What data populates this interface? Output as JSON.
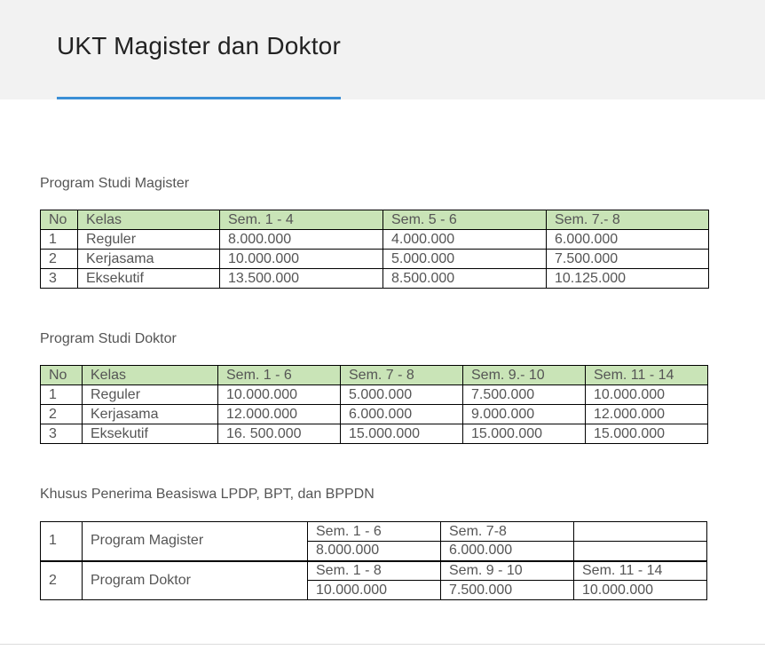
{
  "page": {
    "title": "UKT Magister dan Doktor"
  },
  "colors": {
    "header_bg": "#f2f2f2",
    "accent": "#3b8fd6",
    "table_header_bg": "#c9e4b7"
  },
  "magister": {
    "title": "Program Studi Magister",
    "headers": [
      "No",
      "Kelas",
      "Sem. 1 - 4",
      "Sem. 5 - 6",
      "Sem. 7.- 8"
    ],
    "rows": [
      [
        "1",
        "Reguler",
        "8.000.000",
        "4.000.000",
        "6.000.000"
      ],
      [
        "2",
        "Kerjasama",
        "10.000.000",
        "5.000.000",
        "7.500.000"
      ],
      [
        "3",
        "Eksekutif",
        "13.500.000",
        "8.500.000",
        "10.125.000"
      ]
    ]
  },
  "doktor": {
    "title": "Program Studi Doktor",
    "headers": [
      "No",
      "Kelas",
      "Sem. 1 - 6",
      "Sem. 7 - 8",
      "Sem. 9.- 10",
      "Sem. 11 - 14"
    ],
    "rows": [
      [
        "1",
        "Reguler",
        "10.000.000",
        "5.000.000",
        "7.500.000",
        "10.000.000"
      ],
      [
        "2",
        "Kerjasama",
        "12.000.000",
        "6.000.000",
        "9.000.000",
        "12.000.000"
      ],
      [
        "3",
        "Eksekutif",
        "16. 500.000",
        "15.000.000",
        "15.000.000",
        "15.000.000"
      ]
    ]
  },
  "khusus": {
    "title": "Khusus Penerima Beasiswa LPDP, BPT, dan BPPDN",
    "magister": {
      "no": "1",
      "program": "Program Magister",
      "sem_labels": [
        "Sem. 1 - 6",
        "Sem. 7-8",
        ""
      ],
      "sem_values": [
        "8.000.000",
        "6.000.000",
        ""
      ]
    },
    "doktor": {
      "no": "2",
      "program": "Program Doktor",
      "sem_labels": [
        "Sem. 1 - 8",
        "Sem. 9 - 10",
        "Sem. 11 - 14"
      ],
      "sem_values": [
        "10.000.000",
        "7.500.000",
        "10.000.000"
      ]
    }
  }
}
